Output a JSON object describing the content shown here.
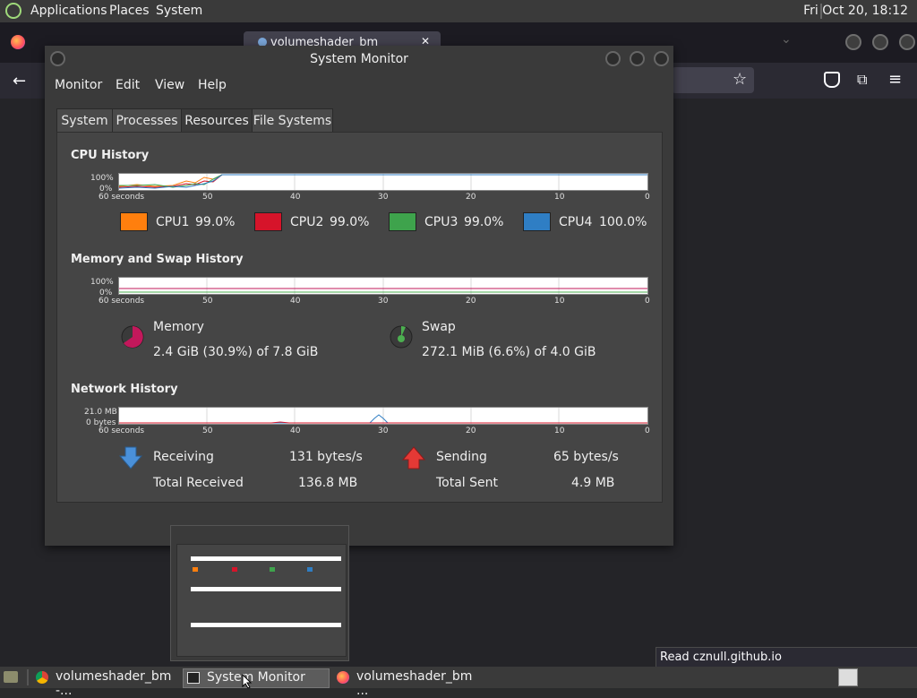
{
  "top_panel": {
    "menu": [
      "Applications",
      "Places",
      "System"
    ],
    "clock": "Fri Oct 20, 18:12"
  },
  "firefox": {
    "tab_title": "volumeshader_bm",
    "close_glyph": "✕"
  },
  "sysmon": {
    "title": "System Monitor",
    "menu": [
      "Monitor",
      "Edit",
      "View",
      "Help"
    ],
    "tabs": [
      "System",
      "Processes",
      "Resources",
      "File Systems"
    ],
    "active_tab": "Resources",
    "cpu": {
      "title": "CPU History",
      "y_top": "100%",
      "y_bottom": "0%",
      "x_labels": [
        "60 seconds",
        "50",
        "40",
        "30",
        "20",
        "10",
        "0"
      ],
      "legend": [
        {
          "name": "CPU1",
          "value": "99.0%",
          "color": "#ff7f0e"
        },
        {
          "name": "CPU2",
          "value": "99.0%",
          "color": "#d6142a"
        },
        {
          "name": "CPU3",
          "value": "99.0%",
          "color": "#3ea34c"
        },
        {
          "name": "CPU4",
          "value": "100.0%",
          "color": "#2f7ec4"
        }
      ]
    },
    "memory": {
      "title": "Memory and Swap History",
      "y_top": "100%",
      "y_bottom": "0%",
      "x_labels": [
        "60 seconds",
        "50",
        "40",
        "30",
        "20",
        "10",
        "0"
      ],
      "memory_label": "Memory",
      "memory_value": "2.4 GiB (30.9%) of 7.8 GiB",
      "memory_color": "#c2185b",
      "swap_label": "Swap",
      "swap_value": "272.1 MiB (6.6%) of 4.0 GiB",
      "swap_color": "#4caf50"
    },
    "network": {
      "title": "Network History",
      "y_top": "21.0 MB",
      "y_bottom": "0 bytes",
      "x_labels": [
        "60 seconds",
        "50",
        "40",
        "30",
        "20",
        "10",
        "0"
      ],
      "receiving_label": "Receiving",
      "receiving_value": "131 bytes/s",
      "total_received_label": "Total Received",
      "total_received_value": "136.8 MB",
      "sending_label": "Sending",
      "sending_value": "65 bytes/s",
      "total_sent_label": "Total Sent",
      "total_sent_value": "4.9 MB"
    }
  },
  "status_toast": "Read cznull.github.io",
  "taskbar": {
    "items": [
      "volumeshader_bm -...",
      "System Monitor",
      "volumeshader_bm ..."
    ]
  }
}
